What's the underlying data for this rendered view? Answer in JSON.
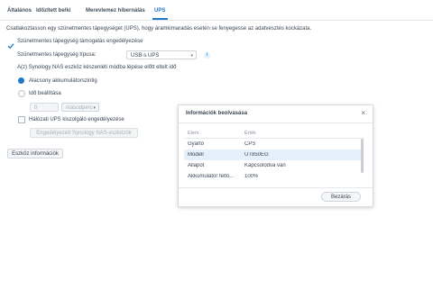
{
  "tabs": [
    {
      "label": "Általános"
    },
    {
      "label": "Időzített be/ki"
    },
    {
      "label": "Merevlemez hibernálás"
    },
    {
      "label": "UPS"
    }
  ],
  "ups": {
    "description": "Csatlakoztasson egy szünetmentes tápegységet (UPS), hogy áramkimaradás esetén se fenyegesse az adatvesztés kockázata.",
    "enable_label": "Szünetmentes tápegység támogatás engedélyezése",
    "type_label": "Szünetmentes tápegység típusa:",
    "type_value": "USB-s UPS",
    "standby_label": "A(z) Synology NAS eszköz készenléti módba lépése előtt eltelt idő",
    "low_battery_label": "Alacsony akkumulátorszintig",
    "time_setting_label": "Idő beállítása",
    "time_value": "0",
    "time_unit": "másodperc",
    "network_ups_label": "Hálózati UPS kiszolgáló engedélyezése",
    "allowed_devices_button": "Engedélyezett Synology NAS-eszközök",
    "device_info_button": "Eszköz információk"
  },
  "modal": {
    "title": "Információk beolvasása",
    "columns": [
      "Elem",
      "Érték"
    ],
    "rows": [
      {
        "item": "Gyártó",
        "value": "CPS"
      },
      {
        "item": "Modell",
        "value": "UT850EG"
      },
      {
        "item": "Állapot",
        "value": "Kapcsolódva van"
      },
      {
        "item": "Akkumulátor feltö...",
        "value": "100%"
      }
    ],
    "close_button": "Bezárás"
  },
  "icons": {
    "checkmark": "check-icon",
    "info": "info-icon",
    "close": "close-icon",
    "dropdown": "chevron-down-icon"
  },
  "colors": {
    "accent": "#1f78c8"
  }
}
